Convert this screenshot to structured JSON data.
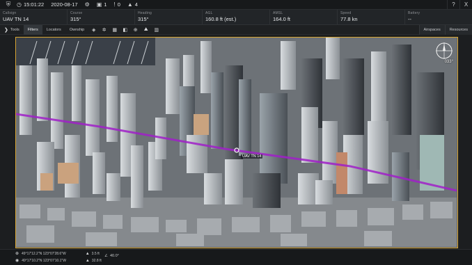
{
  "status": {
    "time": "15:01:22",
    "date": "2020-08-17",
    "gear_count": "1",
    "warnings_count": "0",
    "alerts_count": "4",
    "help_label": "?",
    "close_label": "X"
  },
  "telemetry": [
    {
      "label": "Callsign",
      "value": "UAV TN 14"
    },
    {
      "label": "Course",
      "value": "315°"
    },
    {
      "label": "Heading",
      "value": "315°"
    },
    {
      "label": "AGL",
      "value": "160.8 ft (est.)"
    },
    {
      "label": "AMSL",
      "value": "164.0 ft"
    },
    {
      "label": "Speed",
      "value": "77.8 kn"
    },
    {
      "label": "Battery",
      "value": "--"
    }
  ],
  "toolbar": {
    "tools": "Tools",
    "filters": "Filters",
    "locators": "Locators",
    "ownship": "Ownship",
    "airspaces": "Airspaces",
    "resources": "Resources"
  },
  "map": {
    "uav_label": "UAV TN 14",
    "compass_heading": "033°"
  },
  "bottom": {
    "coord1": "49°17'12.2\"N 123°07'28.6\"W",
    "alt1": "3.5 ft",
    "coord2": "49°17'10.2\"N 123°07'10.1\"W",
    "alt2": "32.8 ft",
    "heading_readout": "40.0°"
  },
  "colors": {
    "accent_border": "#d8a531",
    "flight_path": "#a020c8"
  }
}
